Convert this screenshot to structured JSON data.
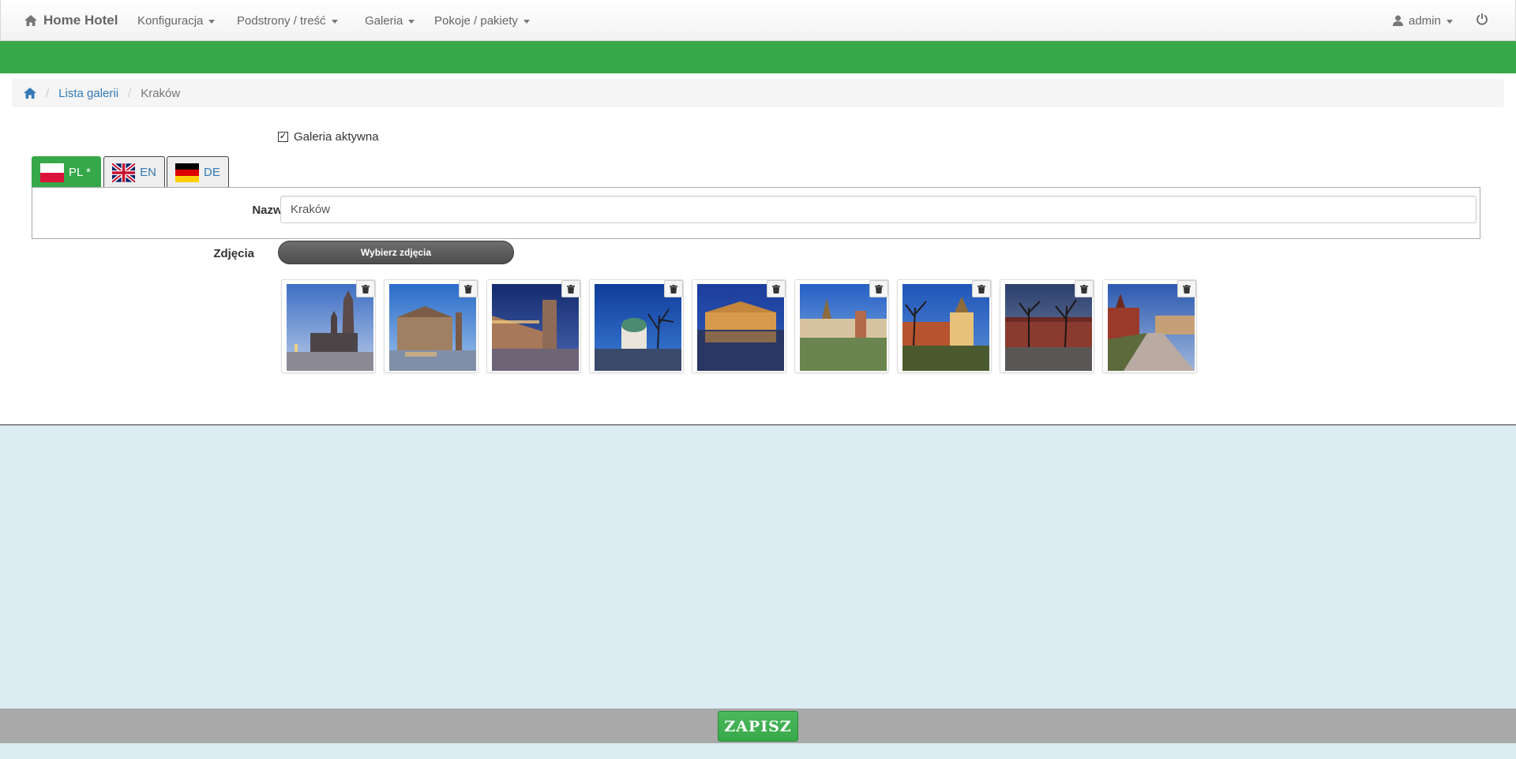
{
  "navbar": {
    "brand": "Home Hotel",
    "menu": [
      {
        "label": "Konfiguracja"
      },
      {
        "label": "Podstrony / treść"
      },
      {
        "label": "Galeria"
      },
      {
        "label": "Pokoje / pakiety"
      }
    ],
    "user": "admin",
    "brand_icon": "home-icon",
    "power_icon": "power-icon"
  },
  "colors": {
    "accent": "#37a849",
    "link": "#337ab7",
    "lower_bg": "#dbedf3",
    "save_bar": "#a9a9a9"
  },
  "breadcrumb": {
    "home_icon": "home-icon",
    "sep1": "/",
    "link": "Lista galerii",
    "sep2": "/",
    "current": "Kraków"
  },
  "form": {
    "active_label": "Galeria aktywna",
    "active_checked": true,
    "tabs": [
      {
        "label": "PL *",
        "flag": "poland-flag",
        "active": true
      },
      {
        "label": "EN",
        "flag": "uk-flag",
        "active": false
      },
      {
        "label": "DE",
        "flag": "germany-flag",
        "active": false
      }
    ],
    "name_label": "Nazwa",
    "name_value": "Kraków",
    "photos_label": "Zdjęcia",
    "choose_button": "Wybierz zdjęcia",
    "thumbnail_count": 9
  },
  "footer": {
    "save_button": "ZAPISZ"
  }
}
